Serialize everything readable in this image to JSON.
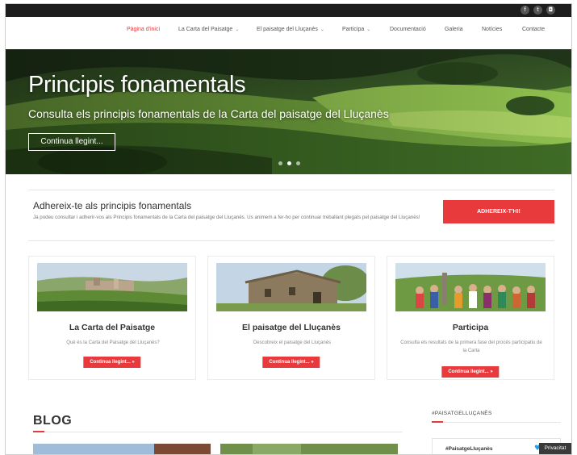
{
  "topbar": {
    "social": [
      {
        "icon": "facebook-icon",
        "glyph": "f"
      },
      {
        "icon": "twitter-icon",
        "glyph": "t"
      },
      {
        "icon": "instagram-icon",
        "glyph": "◘"
      }
    ]
  },
  "nav": {
    "items": [
      {
        "label": "Pàgina d'inici",
        "active": true,
        "dropdown": false
      },
      {
        "label": "La Carta del Paisatge",
        "active": false,
        "dropdown": true
      },
      {
        "label": "El paisatge del Lluçanès",
        "active": false,
        "dropdown": true
      },
      {
        "label": "Participa",
        "active": false,
        "dropdown": true
      },
      {
        "label": "Documentació",
        "active": false,
        "dropdown": false
      },
      {
        "label": "Galeria",
        "active": false,
        "dropdown": false
      },
      {
        "label": "Notícies",
        "active": false,
        "dropdown": false
      },
      {
        "label": "Contacte",
        "active": false,
        "dropdown": false
      }
    ],
    "caret": "⌄"
  },
  "hero": {
    "title": "Principis fonamentals",
    "subtitle": "Consulta els principis fonamentals de la Carta del paisatge del Lluçanès",
    "button": "Continua llegint...",
    "slide_count": 3,
    "active_slide": 1
  },
  "adhere": {
    "title": "Adhereix-te als principis fonamentals",
    "text": "Ja podeu consultar i adherir-vos als Principis fonamentals de la Carta del paisatge del Lluçanès. Us animem a fer-ho per continuar treballant plegats pel paisatge del Lluçanès!",
    "button": "ADHEREIX-T'HI!"
  },
  "cards": [
    {
      "title": "La Carta del Paisatge",
      "desc": "Què és la Carta del Paisatge del Lluçanès?",
      "button": "Continua llegint... »"
    },
    {
      "title": "El paisatge del Lluçanès",
      "desc": "Descobreix el paisatge del Lluçanès",
      "button": "Continua llegint... »"
    },
    {
      "title": "Participa",
      "desc": "Consulta els resultats de la primera fase del procés participatiu de la Carta",
      "button": "Continua llegint... »"
    }
  ],
  "blog": {
    "title": "BLOG"
  },
  "sidebar": {
    "hashtag_title": "#PAISATGELLUÇANÈS",
    "tweet_title": "#PaisatgeLluçanès"
  },
  "privacy": "Privacitat",
  "colors": {
    "accent": "#e8393c",
    "topbar": "#1d1d1d"
  }
}
